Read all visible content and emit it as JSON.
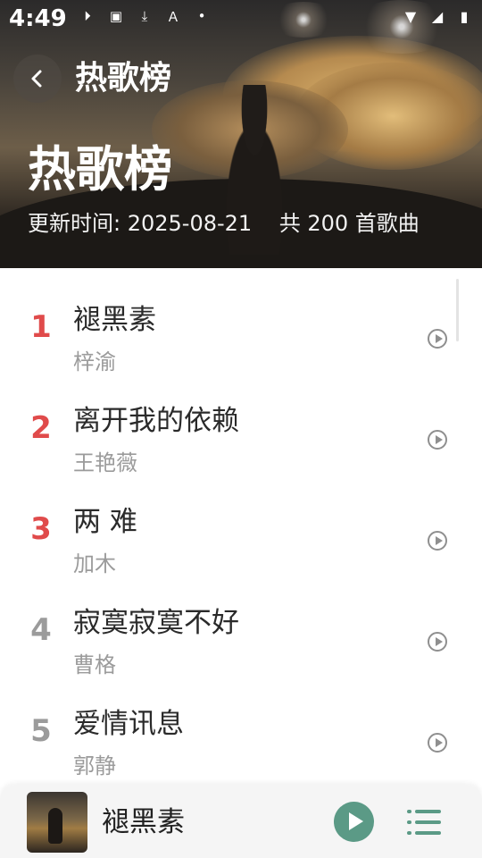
{
  "status_bar": {
    "time": "4:49"
  },
  "header": {
    "title": "热歌榜"
  },
  "hero": {
    "title": "热歌榜",
    "subtitle": "更新时间: 2025-08-21    共 200 首歌曲"
  },
  "songs": [
    {
      "rank": "1",
      "title": "褪黑素",
      "artist": "梓渝"
    },
    {
      "rank": "2",
      "title": "离开我的依赖",
      "artist": "王艳薇"
    },
    {
      "rank": "3",
      "title": "两 难",
      "artist": "加木"
    },
    {
      "rank": "4",
      "title": "寂寞寂寞不好",
      "artist": "曹格"
    },
    {
      "rank": "5",
      "title": "爱情讯息",
      "artist": "郭静"
    }
  ],
  "player": {
    "title": "褪黑素"
  },
  "colors": {
    "accent": "#5b9a86",
    "top_rank": "#e04b4b",
    "normal_rank": "#9b9b9b"
  }
}
